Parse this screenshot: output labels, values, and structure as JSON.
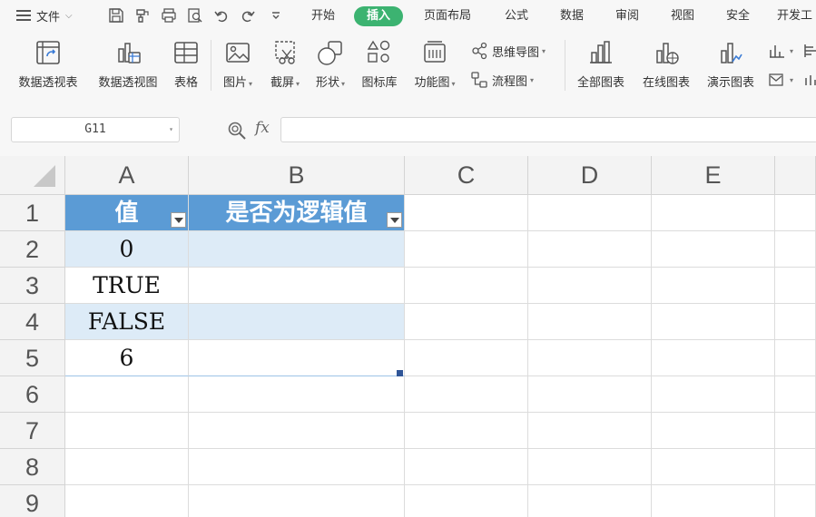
{
  "menubar": {
    "file_label": "文件",
    "tabs": [
      {
        "label": "开始"
      },
      {
        "label": "插入",
        "active": true
      },
      {
        "label": "页面布局"
      },
      {
        "label": "公式"
      },
      {
        "label": "数据"
      },
      {
        "label": "审阅"
      },
      {
        "label": "视图"
      },
      {
        "label": "安全"
      },
      {
        "label": "开发工"
      }
    ],
    "active_color": "#3cb371"
  },
  "ribbon": {
    "pivot_table": "数据透视表",
    "pivot_chart": "数据透视图",
    "table": "表格",
    "picture": "图片",
    "screenshot": "截屏",
    "shapes": "形状",
    "icon_library": "图标库",
    "function_chart": "功能图",
    "mind_map": "思维导图",
    "flowchart": "流程图",
    "all_charts": "全部图表",
    "online_charts": "在线图表",
    "demo_charts": "演示图表"
  },
  "formula_bar": {
    "name_box": "G11",
    "fx_label": "fx",
    "formula": ""
  },
  "sheet": {
    "columns": [
      "A",
      "B",
      "C",
      "D",
      "E"
    ],
    "rows": [
      "1",
      "2",
      "3",
      "4",
      "5",
      "6",
      "7",
      "8",
      "9"
    ],
    "header": {
      "a1": "值",
      "b1": "是否为逻辑值"
    },
    "values": {
      "a2": "0",
      "a3": "TRUE",
      "a4": "FALSE",
      "a5": "6"
    },
    "table_header_color": "#5b9bd5",
    "table_band_color": "#ddebf7"
  }
}
